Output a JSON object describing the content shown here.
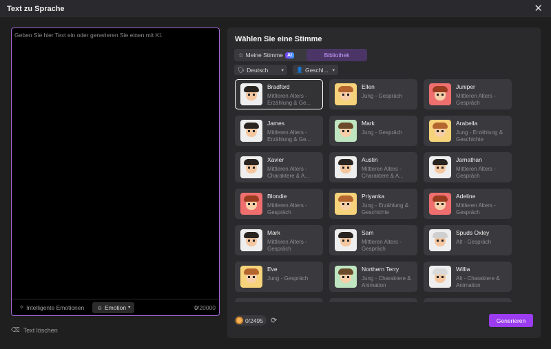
{
  "window": {
    "title": "Text zu Sprache",
    "close_icon": "close-icon"
  },
  "editor": {
    "placeholder": "Geben Sie hier Text ein oder generieren Sie einen mit KI.",
    "smart_emotions_label": "Intelligente Emotionen",
    "emotion_label": "Emotion",
    "count_current": "0",
    "count_max": "/20000"
  },
  "clear_label": "Text löschen",
  "voices_panel": {
    "title": "Wählen Sie eine Stimme",
    "tabs": [
      {
        "label": "Meine Stimme",
        "badge": "AI"
      },
      {
        "label": "Bibliothek"
      }
    ],
    "filters": {
      "language": "Deutsch",
      "gender": "Geschl..."
    },
    "cards": [
      {
        "name": "Bradford",
        "desc": "Mittleren Alters - Erzählung & Ge...",
        "selected": true,
        "bg": "#eeeeee",
        "skin": "#f4c7a1",
        "hair": "#2a2420",
        "avatar": "man-glasses-avatar"
      },
      {
        "name": "Ellen",
        "desc": "Jung - Gespräch",
        "selected": false,
        "bg": "#f6d37a",
        "skin": "#f6cfa9",
        "hair": "#b5652e",
        "avatar": "girl-avatar"
      },
      {
        "name": "Juniper",
        "desc": "Mittleren Alters - Gespräch",
        "selected": false,
        "bg": "#ef6f6f",
        "skin": "#f6cfa9",
        "hair": "#9a3c1f",
        "avatar": "woman-avatar"
      },
      {
        "name": "James",
        "desc": "Mittleren Alters - Erzählung & Ge...",
        "selected": false,
        "bg": "#eeeeee",
        "skin": "#f4c7a1",
        "hair": "#2a2420",
        "avatar": "man-glasses-avatar"
      },
      {
        "name": "Mark",
        "desc": "Jung - Gespräch",
        "selected": false,
        "bg": "#bfe6c0",
        "skin": "#f6cfa9",
        "hair": "#6b4a2a",
        "avatar": "boy-avatar"
      },
      {
        "name": "Arabella",
        "desc": "Jung - Erzählung & Geschichte",
        "selected": false,
        "bg": "#f6d37a",
        "skin": "#f6cfa9",
        "hair": "#b5652e",
        "avatar": "girl-avatar"
      },
      {
        "name": "Xavier",
        "desc": "Mittleren Alters - Charaktere & A...",
        "selected": false,
        "bg": "#eeeeee",
        "skin": "#f4c7a1",
        "hair": "#2a2420",
        "avatar": "man-glasses-avatar"
      },
      {
        "name": "Austin",
        "desc": "Mittleren Alters - Charaktere & A...",
        "selected": false,
        "bg": "#eeeeee",
        "skin": "#f4c7a1",
        "hair": "#2a2420",
        "avatar": "man-glasses-avatar"
      },
      {
        "name": "Jarnathan",
        "desc": "Mittleren Alters - Gespräch",
        "selected": false,
        "bg": "#eeeeee",
        "skin": "#f4c7a1",
        "hair": "#2a2420",
        "avatar": "man-glasses-avatar"
      },
      {
        "name": "Blondie",
        "desc": "Mittleren Alters - Gespräch",
        "selected": false,
        "bg": "#ef6f6f",
        "skin": "#f6cfa9",
        "hair": "#9a3c1f",
        "avatar": "woman-avatar"
      },
      {
        "name": "Priyanka",
        "desc": "Jung - Erzählung & Geschichte",
        "selected": false,
        "bg": "#f6d37a",
        "skin": "#f6cfa9",
        "hair": "#b5652e",
        "avatar": "girl-avatar"
      },
      {
        "name": "Adeline",
        "desc": "Mittleren Alters - Gespräch",
        "selected": false,
        "bg": "#ef6f6f",
        "skin": "#f6cfa9",
        "hair": "#9a3c1f",
        "avatar": "woman-avatar"
      },
      {
        "name": "Mark",
        "desc": "Mittleren Alters - Gespräch",
        "selected": false,
        "bg": "#eeeeee",
        "skin": "#f4c7a1",
        "hair": "#2a2420",
        "avatar": "man-glasses-avatar"
      },
      {
        "name": "Sam",
        "desc": "Mittleren Alters - Gespräch",
        "selected": false,
        "bg": "#eeeeee",
        "skin": "#f4c7a1",
        "hair": "#2a2420",
        "avatar": "man-glasses-avatar"
      },
      {
        "name": "Spuds Oxley",
        "desc": "Alt - Gespräch",
        "selected": false,
        "bg": "#eeeeee",
        "skin": "#f4c7a1",
        "hair": "#cfcfcf",
        "avatar": "elder-man-avatar"
      },
      {
        "name": "Eve",
        "desc": "Jung - Gespräch",
        "selected": false,
        "bg": "#f6d37a",
        "skin": "#f6cfa9",
        "hair": "#b5652e",
        "avatar": "girl-avatar"
      },
      {
        "name": "Northern Terry",
        "desc": "Jung - Charaktere & Animation",
        "selected": false,
        "bg": "#bfe6c0",
        "skin": "#f6cfa9",
        "hair": "#6b4a2a",
        "avatar": "boy-avatar"
      },
      {
        "name": "Willia",
        "desc": "Alt - Charaktere & Animation",
        "selected": false,
        "bg": "#eeeeee",
        "skin": "#f4c7a1",
        "hair": "#d9d9d9",
        "avatar": "elder-woman-avatar"
      },
      {
        "name": "",
        "desc": "",
        "selected": false,
        "bg": "#eeeeee",
        "skin": "#f4c7a1",
        "hair": "#2a2420",
        "avatar": "partial-card-avatar"
      },
      {
        "name": "",
        "desc": "",
        "selected": false,
        "bg": "#eeeeee",
        "skin": "#f4c7a1",
        "hair": "#2a2420",
        "avatar": "partial-card-avatar"
      },
      {
        "name": "",
        "desc": "",
        "selected": false,
        "bg": "#eeeeee",
        "skin": "#f4c7a1",
        "hair": "#2a2420",
        "avatar": "partial-card-avatar"
      }
    ]
  },
  "footer": {
    "credits_used": "0",
    "credits_total": "/2495",
    "generate_label": "Generieren"
  },
  "colors": {
    "accent": "#9b3cf0",
    "editor_border": "#a66ad6",
    "panel_bg": "#2a2a2d",
    "card_bg": "#3a3a3e"
  }
}
